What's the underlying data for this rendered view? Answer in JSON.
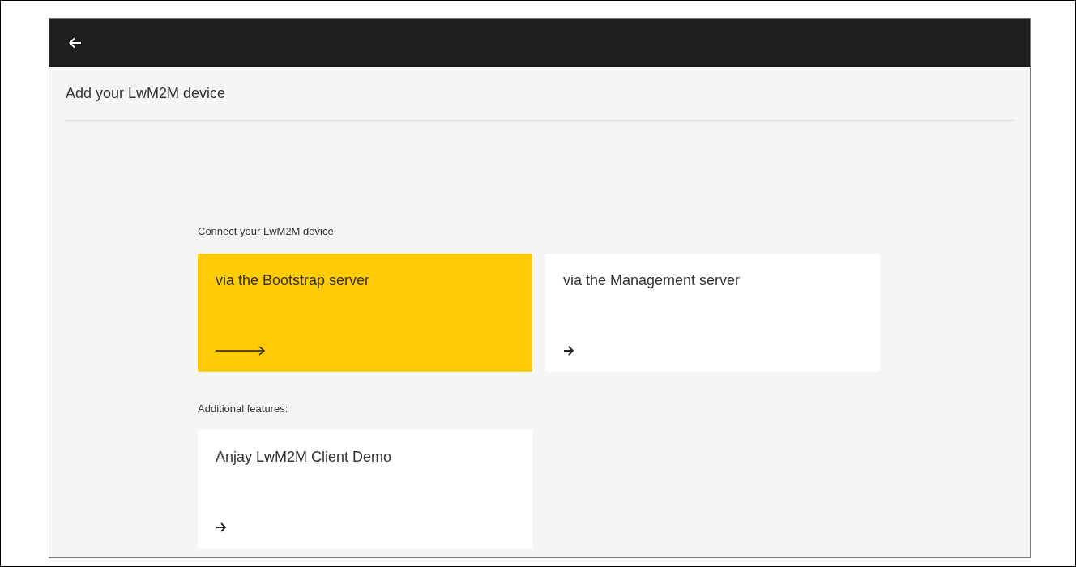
{
  "page_title": "Add your LwM2M device",
  "sections": [
    {
      "label": "Connect your LwM2M device",
      "cards": [
        {
          "title": "via the Bootstrap server",
          "selected": true
        },
        {
          "title": "via the Management server",
          "selected": false
        }
      ]
    },
    {
      "label": "Additional features:",
      "cards": [
        {
          "title": "Anjay LwM2M Client Demo",
          "selected": false
        }
      ]
    }
  ]
}
